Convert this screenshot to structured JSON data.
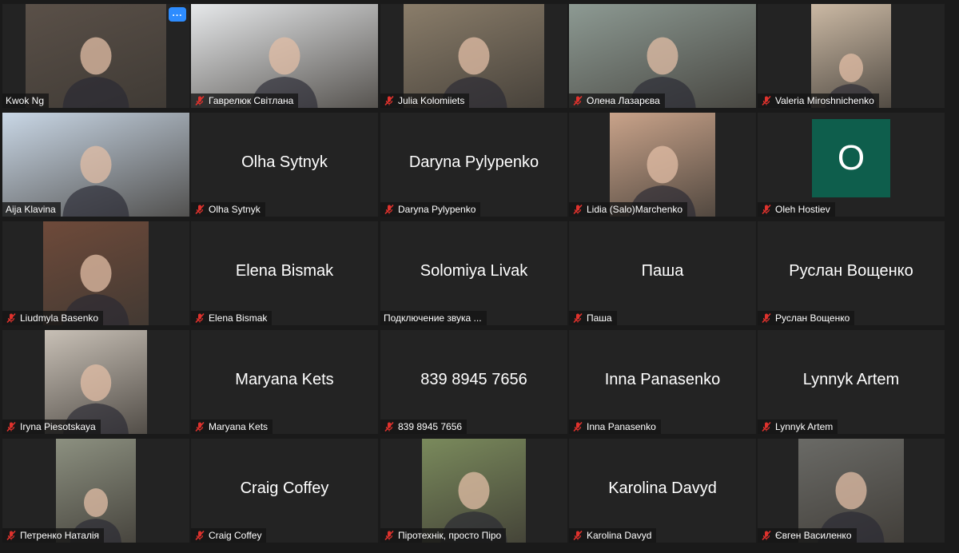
{
  "colors": {
    "background": "#1a1a1a",
    "tile": "#232323",
    "active_speaker_border": "#d6e36a",
    "muted_icon": "#e0322d",
    "more_button": "#2d8cff",
    "avatar_bg": "#0e5e4c"
  },
  "participants": [
    {
      "label": "Kwok Ng",
      "muted": false,
      "display": "video",
      "video_width": 176,
      "video_bg": "#5a5048",
      "more": "..."
    },
    {
      "label": "Гаврелюк Світлана",
      "muted": true,
      "display": "video",
      "video_width": 234,
      "video_bg": "#e6e8ea"
    },
    {
      "label": "Julia Kolomiiets",
      "muted": true,
      "display": "video",
      "video_width": 176,
      "video_bg": "#8a7d6a"
    },
    {
      "label": "Олена Лазарєва",
      "muted": true,
      "display": "video",
      "video_width": 234,
      "video_bg": "#8d9a93"
    },
    {
      "label": "Valeria Miroshnichenko",
      "muted": true,
      "display": "video",
      "video_width": 100,
      "video_bg": "#cbb9a4"
    },
    {
      "label": "Aija Klavina",
      "muted": false,
      "display": "video",
      "video_width": 234,
      "video_bg": "#c9d7e6",
      "active": true
    },
    {
      "label": "Olha Sytnyk",
      "muted": true,
      "display": "name",
      "big_name": "Olha Sytnyk"
    },
    {
      "label": "Daryna Pylypenko",
      "muted": true,
      "display": "name",
      "big_name": "Daryna Pylypenko"
    },
    {
      "label": "Lidia (Salo)Marchenko",
      "muted": true,
      "display": "video",
      "video_width": 132,
      "video_bg": "#c9a38a"
    },
    {
      "label": "Oleh Hostiev",
      "muted": true,
      "display": "avatar",
      "avatar_letter": "O"
    },
    {
      "label": "Liudmyla Basenko",
      "muted": true,
      "display": "video",
      "video_width": 132,
      "video_bg": "#6e4a3a"
    },
    {
      "label": "Elena Bismak",
      "muted": true,
      "display": "name",
      "big_name": "Elena Bismak"
    },
    {
      "label": "Подключение звука ...",
      "muted": false,
      "display": "name",
      "big_name": "Solomiya Livak"
    },
    {
      "label": "Паша",
      "muted": true,
      "display": "name",
      "big_name": "Паша"
    },
    {
      "label": "Руслан Вощенко",
      "muted": true,
      "display": "name",
      "big_name": "Руслан Вощенко"
    },
    {
      "label": "Iryna Piesotskaya",
      "muted": true,
      "display": "video",
      "video_width": 128,
      "video_bg": "#c8c0b6"
    },
    {
      "label": "Maryana Kets",
      "muted": true,
      "display": "name",
      "big_name": "Maryana Kets"
    },
    {
      "label": "839 8945 7656",
      "muted": true,
      "display": "name",
      "big_name": "839 8945 7656"
    },
    {
      "label": "Inna Panasenko",
      "muted": true,
      "display": "name",
      "big_name": "Inna Panasenko"
    },
    {
      "label": "Lynnyk Artem",
      "muted": true,
      "display": "name",
      "big_name": "Lynnyk Artem"
    },
    {
      "label": "Петренко Наталія",
      "muted": true,
      "display": "video",
      "video_width": 100,
      "video_bg": "#8c9080"
    },
    {
      "label": "Craig Coffey",
      "muted": true,
      "display": "name",
      "big_name": "Craig Coffey"
    },
    {
      "label": "Піротехнік, просто Піро",
      "muted": true,
      "display": "video",
      "video_width": 130,
      "video_bg": "#7a8a5c"
    },
    {
      "label": "Karolina Davyd",
      "muted": true,
      "display": "name",
      "big_name": "Karolina Davyd"
    },
    {
      "label": "Євген Василенко",
      "muted": true,
      "display": "video",
      "video_width": 132,
      "video_bg": "#6a6a66"
    }
  ]
}
